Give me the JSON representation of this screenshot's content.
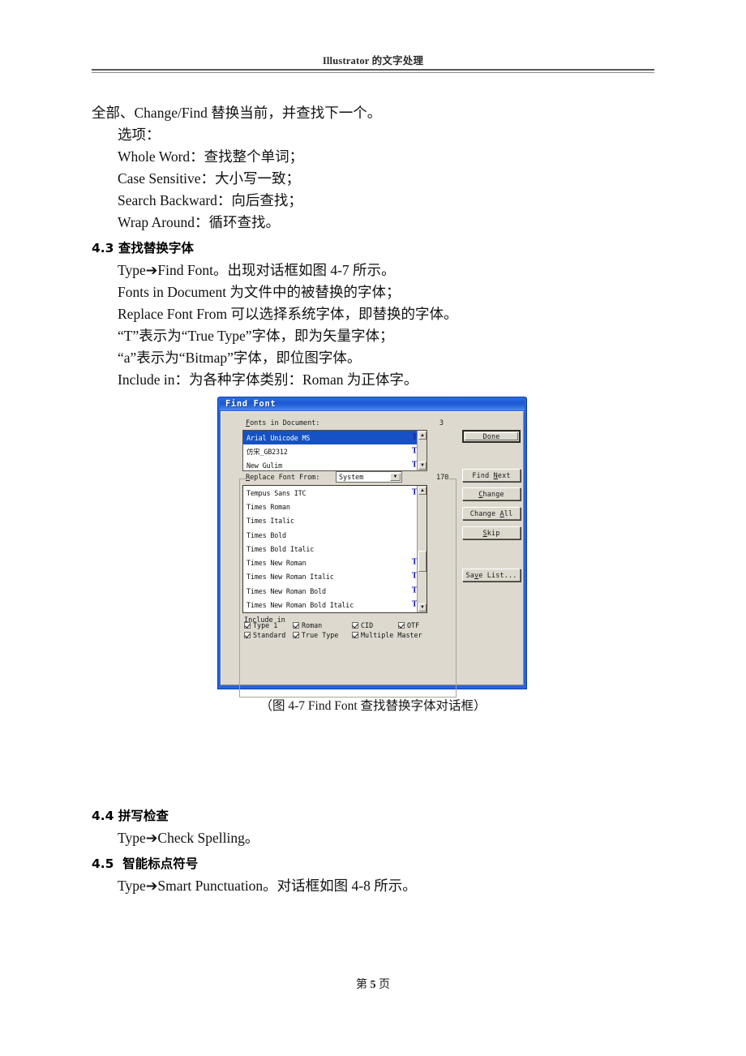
{
  "header": {
    "running_head": "Illustrator 的文字处理"
  },
  "body_top": {
    "lines": [
      {
        "text": "全部、Change/Find 替换当前，并查找下一个。",
        "indent": 0
      },
      {
        "text": "选项：",
        "indent": 1
      },
      {
        "text": "Whole Word：查找整个单词；",
        "indent": 1
      },
      {
        "text": "Case Sensitive：大小写一致；",
        "indent": 1
      },
      {
        "text": "Search Backward：向后查找；",
        "indent": 1
      },
      {
        "text": "Wrap Around：循环查找。",
        "indent": 1
      }
    ]
  },
  "section_43": {
    "heading": "4.3 查找替换字体",
    "lines": [
      {
        "text": "Type➔Find Font。出现对话框如图 4-7 所示。",
        "indent": 1
      },
      {
        "text": "Fonts in Document 为文件中的被替换的字体；",
        "indent": 1
      },
      {
        "text": "Replace Font From 可以选择系统字体，即替换的字体。",
        "indent": 1
      },
      {
        "text": "“T”表示为“True Type”字体，即为矢量字体；",
        "indent": 1
      },
      {
        "text": "“a”表示为“Bitmap”字体，即位图字体。",
        "indent": 1
      },
      {
        "text": "Include in：为各种字体类别：Roman 为正体字。",
        "indent": 1
      }
    ]
  },
  "dialog": {
    "title": "Find Font",
    "fonts_in_document_label": "Fonts in Document:",
    "fonts_in_document_count": "3",
    "fonts_in_document": [
      {
        "name": "Arial Unicode MS",
        "icon": "truetype-icon",
        "selected": true
      },
      {
        "name": "仿宋_GB2312",
        "icon": "truetype-icon",
        "selected": false
      },
      {
        "name": "New Gulim",
        "icon": "truetype-icon",
        "selected": false
      }
    ],
    "replace_font_from_label": "Replace Font From:",
    "replace_source_value": "System",
    "replace_count": "170",
    "system_fonts": [
      {
        "name": "Tempus Sans ITC",
        "icon": "truetype-icon"
      },
      {
        "name": "Times Roman",
        "icon": "bitmap-icon"
      },
      {
        "name": "Times Italic",
        "icon": "bitmap-icon"
      },
      {
        "name": "Times Bold",
        "icon": "bitmap-icon"
      },
      {
        "name": "Times Bold Italic",
        "icon": "bitmap-icon"
      },
      {
        "name": "Times New Roman",
        "icon": "truetype-icon"
      },
      {
        "name": "Times New Roman Italic",
        "icon": "truetype-icon"
      },
      {
        "name": "Times New Roman Bold",
        "icon": "truetype-icon"
      },
      {
        "name": "Times New Roman Bold Italic",
        "icon": "truetype-icon"
      }
    ],
    "include_in_label": "Include in",
    "include_in_row1": [
      {
        "label": "Type 1",
        "checked": true
      },
      {
        "label": "Roman",
        "checked": true
      },
      {
        "label": "CID",
        "checked": true
      },
      {
        "label": "OTF",
        "checked": true
      }
    ],
    "include_in_row2": [
      {
        "label": "Standard",
        "checked": true
      },
      {
        "label": "True Type",
        "checked": true
      },
      {
        "label": "Multiple Master",
        "checked": true
      }
    ],
    "buttons": {
      "done": "Done",
      "find_next": "Find Next",
      "change": "Change",
      "change_all": "Change All",
      "skip": "Skip",
      "save_list": "Save List..."
    },
    "colors": {
      "titlebar": "#1a58d4",
      "face": "#ddd9cf",
      "selection": "#1552c4",
      "truetype_icon": "#2222aa",
      "bitmap_icon": "#b02a2a"
    }
  },
  "figure_caption": "（图 4-7 Find Font  查找替换字体对话框）",
  "section_44": {
    "heading": "4.4 拼写检查",
    "lines": [
      {
        "text": "Type➔Check Spelling。",
        "indent": 1
      }
    ]
  },
  "section_45": {
    "heading": "4.5  智能标点符号",
    "lines": [
      {
        "text": "Type➔Smart Punctuation。对话框如图 4-8 所示。",
        "indent": 1
      }
    ]
  },
  "footer": {
    "prefix": "第",
    "page_number": "5",
    "suffix": "页"
  }
}
